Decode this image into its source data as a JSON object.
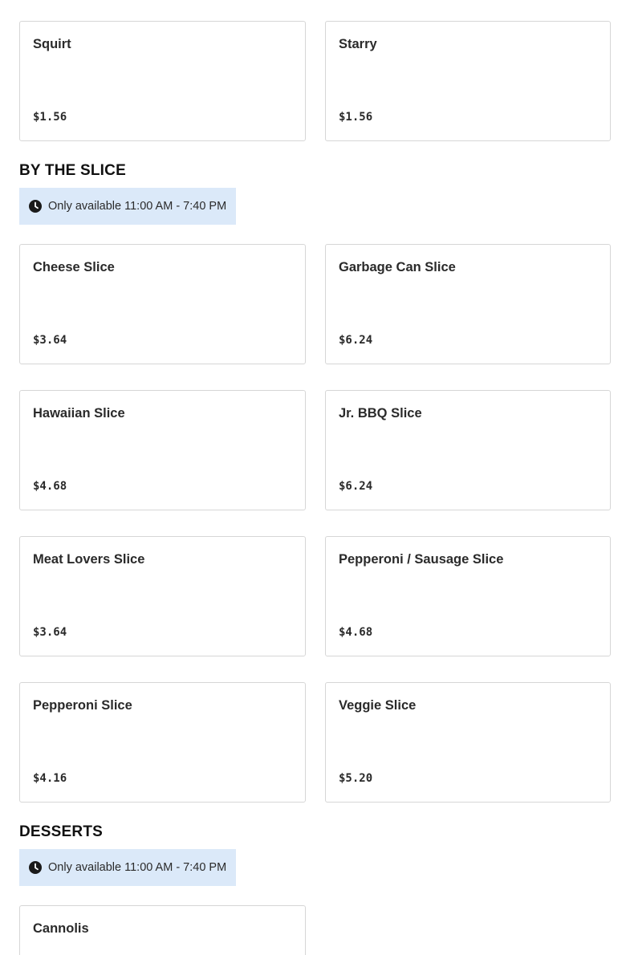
{
  "top_items": [
    {
      "name": "Squirt",
      "price": "$1.56"
    },
    {
      "name": "Starry",
      "price": "$1.56"
    }
  ],
  "sections": [
    {
      "title": "BY THE SLICE",
      "availability": "Only available 11:00 AM - 7:40 PM",
      "items": [
        {
          "name": "Cheese Slice",
          "price": "$3.64"
        },
        {
          "name": "Garbage Can Slice",
          "price": "$6.24"
        },
        {
          "name": "Hawaiian Slice",
          "price": "$4.68"
        },
        {
          "name": "Jr. BBQ Slice",
          "price": "$6.24"
        },
        {
          "name": "Meat Lovers Slice",
          "price": "$3.64"
        },
        {
          "name": "Pepperoni / Sausage Slice",
          "price": "$4.68"
        },
        {
          "name": "Pepperoni Slice",
          "price": "$4.16"
        },
        {
          "name": "Veggie Slice",
          "price": "$5.20"
        }
      ]
    },
    {
      "title": "DESSERTS",
      "availability": "Only available 11:00 AM - 7:40 PM",
      "items": [
        {
          "name": "Cannolis"
        }
      ]
    }
  ],
  "icons": {
    "availability": "clock-icon"
  }
}
